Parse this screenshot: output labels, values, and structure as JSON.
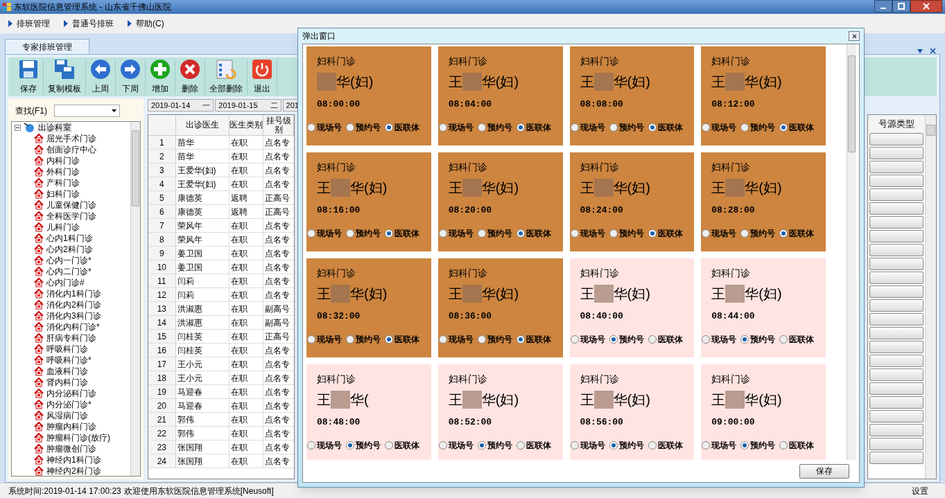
{
  "window": {
    "title": "东软医院信息管理系统 - 山东省千佛山医院"
  },
  "menu": [
    {
      "label": "排班管理"
    },
    {
      "label": "普通号排班"
    },
    {
      "label": "帮助(C)"
    }
  ],
  "tab": {
    "label": "专家排班管理",
    "selected": true
  },
  "toolbar": [
    {
      "label": "保存",
      "kind": "save"
    },
    {
      "label": "复制模板",
      "kind": "copy"
    },
    {
      "label": "上周",
      "kind": "prev"
    },
    {
      "label": "下周",
      "kind": "next"
    },
    {
      "label": "增加",
      "kind": "add"
    },
    {
      "label": "删除",
      "kind": "delete"
    },
    {
      "label": "全部删除",
      "kind": "clear"
    },
    {
      "label": "退出",
      "kind": "exit"
    }
  ],
  "search": {
    "label": "查找(F1)"
  },
  "tree": {
    "label": "出诊科室",
    "expanded": true,
    "children": [
      {
        "label": "屈光手术门诊"
      },
      {
        "label": "创面诊疗中心"
      },
      {
        "label": "内科门诊"
      },
      {
        "label": "外科门诊"
      },
      {
        "label": "产科门诊"
      },
      {
        "label": "妇科门诊"
      },
      {
        "label": "儿童保健门诊"
      },
      {
        "label": "全科医学门诊"
      },
      {
        "label": "儿科门诊"
      },
      {
        "label": "心内1科门诊"
      },
      {
        "label": "心内2科门诊"
      },
      {
        "label": "心内一门诊*"
      },
      {
        "label": "心内二门诊*"
      },
      {
        "label": "心内门诊#"
      },
      {
        "label": "消化内1科门诊"
      },
      {
        "label": "消化内2科门诊"
      },
      {
        "label": "消化内3科门诊"
      },
      {
        "label": "消化内科门诊*"
      },
      {
        "label": "肝病专科门诊"
      },
      {
        "label": "呼吸科门诊"
      },
      {
        "label": "呼吸科门诊*"
      },
      {
        "label": "血液科门诊"
      },
      {
        "label": "肾内科门诊"
      },
      {
        "label": "内分泌科门诊"
      },
      {
        "label": "内分泌门诊*"
      },
      {
        "label": "风湿病门诊"
      },
      {
        "label": "肿瘤内科门诊"
      },
      {
        "label": "肿瘤科门诊(放疗)"
      },
      {
        "label": "肿瘤微创门诊"
      },
      {
        "label": "神经内1科门诊"
      },
      {
        "label": "神经内2科门诊"
      }
    ]
  },
  "date_tabs": [
    {
      "date": "2019-01-14",
      "weekday": "一"
    },
    {
      "date": "2019-01-15",
      "weekday": "二"
    },
    {
      "date": "201"
    }
  ],
  "table": {
    "columns": [
      "",
      "出诊医生",
      "医生类别",
      "挂号级别"
    ],
    "rows": [
      [
        "1",
        "苗华",
        "在职",
        "点名专"
      ],
      [
        "2",
        "苗华",
        "在职",
        "点名专"
      ],
      [
        "3",
        "王爱华(妇)",
        "在职",
        "点名专"
      ],
      [
        "4",
        "王爱华(妇)",
        "在职",
        "点名专"
      ],
      [
        "5",
        "康德英",
        "返聘",
        "正高号"
      ],
      [
        "6",
        "康德英",
        "返聘",
        "正高号"
      ],
      [
        "7",
        "荣风年",
        "在职",
        "点名专"
      ],
      [
        "8",
        "荣风年",
        "在职",
        "点名专"
      ],
      [
        "9",
        "姜卫国",
        "在职",
        "点名专"
      ],
      [
        "10",
        "姜卫国",
        "在职",
        "点名专"
      ],
      [
        "11",
        "闫莉",
        "在职",
        "点名专"
      ],
      [
        "12",
        "闫莉",
        "在职",
        "点名专"
      ],
      [
        "13",
        "洪淑惠",
        "在职",
        "副高号"
      ],
      [
        "14",
        "洪淑惠",
        "在职",
        "副高号"
      ],
      [
        "15",
        "闫桂英",
        "在职",
        "正高号"
      ],
      [
        "16",
        "闫桂英",
        "在职",
        "点名专"
      ],
      [
        "17",
        "王小元",
        "在职",
        "点名专"
      ],
      [
        "18",
        "王小元",
        "在职",
        "点名专"
      ],
      [
        "19",
        "马迎春",
        "在职",
        "点名专"
      ],
      [
        "20",
        "马迎春",
        "在职",
        "点名专"
      ],
      [
        "21",
        "郭伟",
        "在职",
        "点名专"
      ],
      [
        "22",
        "郭伟",
        "在职",
        "点名专"
      ],
      [
        "23",
        "张国翔",
        "在职",
        "点名专"
      ],
      [
        "24",
        "张国翔",
        "在职",
        "点名专"
      ]
    ]
  },
  "right_column": {
    "header": "号源类型"
  },
  "popup": {
    "title": "弹出窗口",
    "save_button": "保存",
    "cards": [
      {
        "clinic": "妇科门诊",
        "name_end": "华(妇)",
        "time": "08:00:00",
        "color": "#cd853f",
        "options": [
          {
            "label": "现场号",
            "selected": false
          },
          {
            "label": "预约号",
            "selected": false
          },
          {
            "label": "医联体",
            "selected": true
          }
        ]
      },
      {
        "clinic": "妇科门诊",
        "name_start": "王",
        "name_end": "华(妇)",
        "time": "08:04:00",
        "color": "#cd853f",
        "options": [
          {
            "label": "现场号",
            "selected": false
          },
          {
            "label": "预约号",
            "selected": false
          },
          {
            "label": "医联体",
            "selected": true
          }
        ]
      },
      {
        "clinic": "妇科门诊",
        "name_start": "王",
        "name_end": "华(妇)",
        "time": "08:08:00",
        "color": "#cd853f",
        "options": [
          {
            "label": "现场号",
            "selected": false
          },
          {
            "label": "预约号",
            "selected": false
          },
          {
            "label": "医联体",
            "selected": true
          }
        ]
      },
      {
        "clinic": "妇科门诊",
        "name_start": "王",
        "name_end": "华(妇)",
        "time": "08:12:00",
        "color": "#cd853f",
        "options": [
          {
            "label": "现场号",
            "selected": false
          },
          {
            "label": "预约号",
            "selected": false
          },
          {
            "label": "医联体",
            "selected": true
          }
        ]
      },
      {
        "clinic": "妇科门诊",
        "name_start": "王",
        "name_end": "华(妇)",
        "time": "08:16:00",
        "color": "#cd853f",
        "options": [
          {
            "label": "现场号",
            "selected": false
          },
          {
            "label": "预约号",
            "selected": false
          },
          {
            "label": "医联体",
            "selected": true
          }
        ]
      },
      {
        "clinic": "妇科门诊",
        "name_start": "王",
        "name_end": "华(妇)",
        "time": "08:20:00",
        "color": "#cd853f",
        "options": [
          {
            "label": "现场号",
            "selected": false
          },
          {
            "label": "预约号",
            "selected": false
          },
          {
            "label": "医联体",
            "selected": true
          }
        ]
      },
      {
        "clinic": "妇科门诊",
        "name_start": "王",
        "name_end": "华(妇)",
        "time": "08:24:00",
        "color": "#cd853f",
        "options": [
          {
            "label": "现场号",
            "selected": false
          },
          {
            "label": "预约号",
            "selected": false
          },
          {
            "label": "医联体",
            "selected": true
          }
        ]
      },
      {
        "clinic": "妇科门诊",
        "name_start": "王",
        "name_end": "华(妇)",
        "time": "08:28:00",
        "color": "#cd853f",
        "options": [
          {
            "label": "现场号",
            "selected": false
          },
          {
            "label": "预约号",
            "selected": false
          },
          {
            "label": "医联体",
            "selected": true
          }
        ]
      },
      {
        "clinic": "妇科门诊",
        "name_start": "王",
        "name_end": "华(妇)",
        "time": "08:32:00",
        "color": "#cd853f",
        "options": [
          {
            "label": "现场号",
            "selected": false
          },
          {
            "label": "预约号",
            "selected": false
          },
          {
            "label": "医联体",
            "selected": true
          }
        ]
      },
      {
        "clinic": "妇科门诊",
        "name_start": "王",
        "name_end": "华(妇)",
        "time": "08:36:00",
        "color": "#cd853f",
        "options": [
          {
            "label": "现场号",
            "selected": false
          },
          {
            "label": "预约号",
            "selected": false
          },
          {
            "label": "医联体",
            "selected": true
          }
        ]
      },
      {
        "clinic": "妇科门诊",
        "name_start": "王",
        "name_end": "华(妇)",
        "time": "08:40:00",
        "color": "#ffe4e1",
        "options": [
          {
            "label": "现场号",
            "selected": false
          },
          {
            "label": "预约号",
            "selected": true
          },
          {
            "label": "医联体",
            "selected": false
          }
        ]
      },
      {
        "clinic": "妇科门诊",
        "name_start": "王",
        "name_end": "华(妇)",
        "time": "08:44:00",
        "color": "#ffe4e1",
        "options": [
          {
            "label": "现场号",
            "selected": false
          },
          {
            "label": "预约号",
            "selected": true
          },
          {
            "label": "医联体",
            "selected": false
          }
        ]
      },
      {
        "clinic": "妇科门诊",
        "name_start": "王",
        "name_end": "华(",
        "time": "08:48:00",
        "color": "#ffe4e1",
        "options": [
          {
            "label": "现场号",
            "selected": false
          },
          {
            "label": "预约号",
            "selected": true
          },
          {
            "label": "医联体",
            "selected": false
          }
        ]
      },
      {
        "clinic": "妇科门诊",
        "name_start": "王",
        "name_end": "华(妇)",
        "time": "08:52:00",
        "color": "#ffe4e1",
        "options": [
          {
            "label": "现场号",
            "selected": false
          },
          {
            "label": "预约号",
            "selected": true
          },
          {
            "label": "医联体",
            "selected": false
          }
        ]
      },
      {
        "clinic": "妇科门诊",
        "name_start": "王",
        "name_end": "华(妇)",
        "time": "08:56:00",
        "color": "#ffe4e1",
        "options": [
          {
            "label": "现场号",
            "selected": false
          },
          {
            "label": "预约号",
            "selected": true
          },
          {
            "label": "医联体",
            "selected": false
          }
        ]
      },
      {
        "clinic": "妇科门诊",
        "name_start": "王",
        "name_end": "华(妇)",
        "time": "09:00:00",
        "color": "#ffe4e1",
        "options": [
          {
            "label": "现场号",
            "selected": false
          },
          {
            "label": "预约号",
            "selected": true
          },
          {
            "label": "医联体",
            "selected": false
          }
        ]
      }
    ]
  },
  "status_bar": {
    "system_time": "系统时间:2019-01-14 17:00:23",
    "welcome": "欢迎使用东软医院信息管理系统[Neusoft]",
    "settings": "设置"
  }
}
